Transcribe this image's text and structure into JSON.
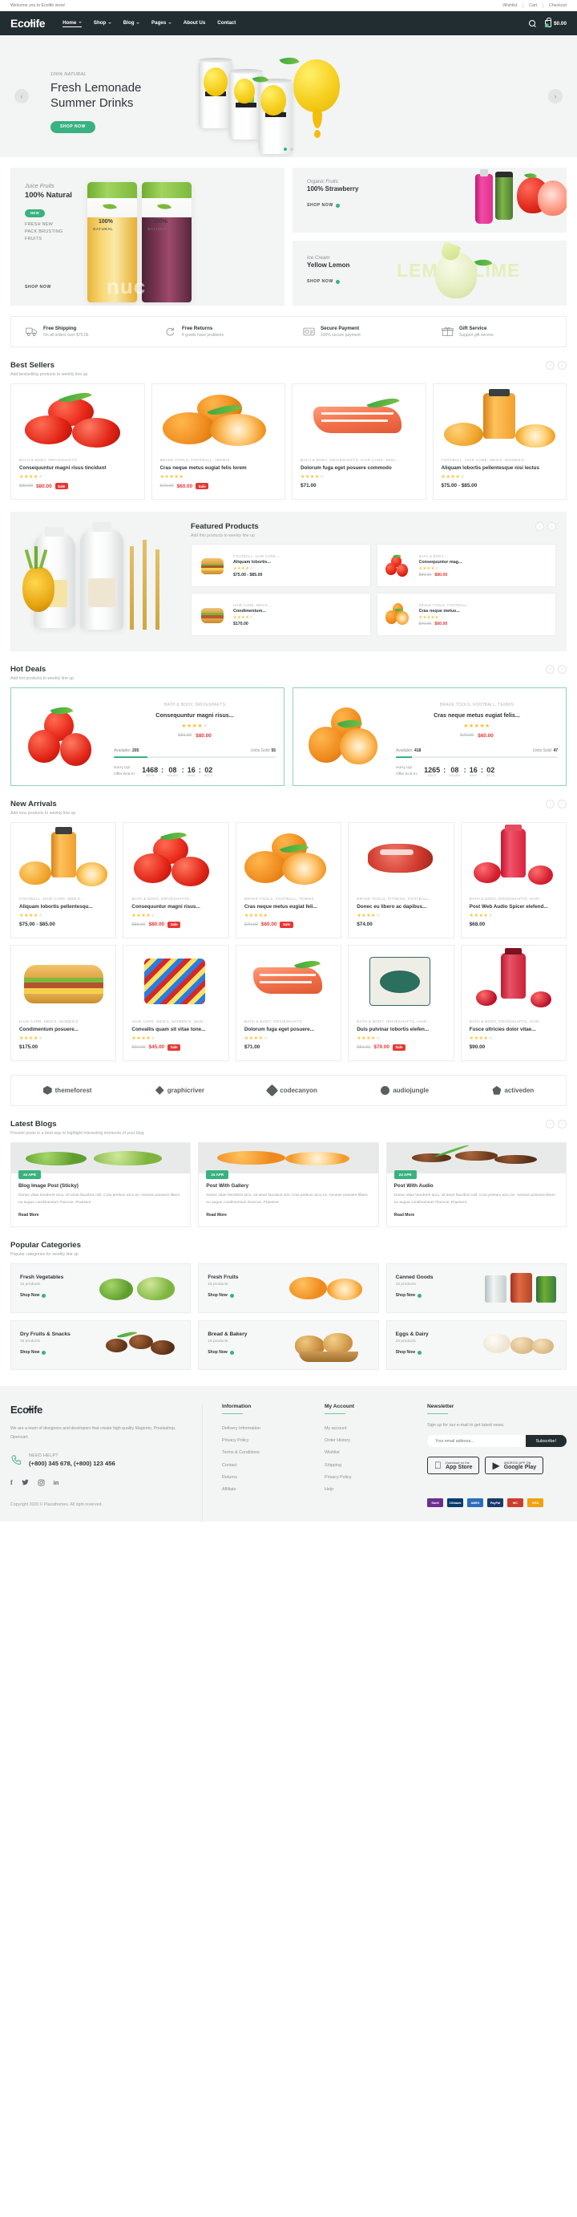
{
  "topbar": {
    "welcome": "Welcome you to Ecolife store!",
    "links": [
      "Wishlist",
      "Cart",
      "Checkout"
    ]
  },
  "header": {
    "logo": "Ecolife",
    "nav": [
      {
        "label": "Home",
        "caret": true,
        "active": true
      },
      {
        "label": "Shop",
        "caret": true,
        "active": false
      },
      {
        "label": "Blog",
        "caret": true,
        "active": false
      },
      {
        "label": "Pages",
        "caret": true,
        "active": false
      },
      {
        "label": "About Us",
        "caret": false,
        "active": false
      },
      {
        "label": "Contact",
        "caret": false,
        "active": false
      }
    ],
    "search_icon": "search-icon",
    "cart_icon": "cart-icon",
    "cart_count": "0",
    "cart_total": "$0.00"
  },
  "hero": {
    "eyebrow": "100% NATURAL",
    "title_line1": "Fresh Lemonade",
    "title_line2": "Summer Drinks",
    "cta": "SHOP NOW",
    "prev": "‹",
    "next": "›",
    "dots": 2,
    "active_dot": 0
  },
  "promos": {
    "large": {
      "eyebrow": "Juice Fruits",
      "title": "100% Natural",
      "badge": "NEW",
      "sub_line1": "FRESH NEW",
      "sub_line2": "PACK BRUSTING",
      "sub_line3": "FRUITS",
      "cta": "SHOP NOW",
      "label_a": "100%",
      "label_b": "NATURAL",
      "word": "nuc"
    },
    "small1": {
      "eyebrow": "Organic Fruits",
      "title": "100% Strawberry",
      "cta": "SHOP NOW"
    },
    "small2": {
      "eyebrow": "Ice Cream",
      "title": "Yellow Lemon",
      "cta": "SHOP NOW",
      "bigword": "LEMON LIME"
    }
  },
  "services": [
    {
      "icon": "truck-icon",
      "title": "Free Shipping",
      "sub": "On all orders over $75.00"
    },
    {
      "icon": "returns-icon",
      "title": "Free Returns",
      "sub": "If goods have problems"
    },
    {
      "icon": "secure-payment-icon",
      "title": "Secure Payment",
      "sub": "100% secure payment"
    },
    {
      "icon": "gift-icon",
      "title": "Gift Service",
      "sub": "Support gift service"
    }
  ],
  "best_sellers": {
    "title": "Best Sellers",
    "sub": "Add bestselling products to weekly line up",
    "products": [
      {
        "img": "tomatoes",
        "cat": "BATH & BODY, DRIVESHAFTS",
        "name": "Consequuntur magni risus tincidunt",
        "stars": 4,
        "old": "$89.00",
        "new": "$80.00",
        "sale": "Sale"
      },
      {
        "img": "oranges",
        "cat": "BRAKE TOOLS, FOOTBALL, TENNIS",
        "name": "Cras neque metus eugiat felis lorem",
        "stars": 5,
        "old": "$70.00",
        "new": "$60.00",
        "sale": "Sale"
      },
      {
        "img": "salmon",
        "cat": "BATH & BODY, DRIVESHAFTS, HAIR CARE, SKIN...",
        "name": "Dolorum fuga eget posuere commodo",
        "stars": 4,
        "reg": "$71.00"
      },
      {
        "img": "juice",
        "cat": "FOOTBALL, HAIR CARE, MEN'S, WOMEN'S",
        "name": "Aliquam lobortis pellentesque nisi lectus",
        "stars": 4,
        "reg": "$75.00 - $85.00"
      }
    ]
  },
  "featured": {
    "title": "Featured Products",
    "sub": "Add this products to weekly line up",
    "products": [
      {
        "img": "burger",
        "cat": "FOOTBALL, HAIR CARE,...",
        "name": "Aliquam lobortis...",
        "stars": 4,
        "reg": "$75.00 - $85.00"
      },
      {
        "img": "tomatoes",
        "cat": "BATH & BODY,...",
        "name": "Consequuntur mag...",
        "stars": 4,
        "old": "$89.00",
        "new": "$80.00"
      },
      {
        "img": "sandwich",
        "cat": "HAIR CARE, MEN'S,...",
        "name": "Condimentum...",
        "stars": 4,
        "reg": "$170.00"
      },
      {
        "img": "oranges",
        "cat": "BRAKE TOOLS, FOOTBALL...",
        "name": "Cras neque metus...",
        "stars": 5,
        "old": "$70.00",
        "new": "$60.00"
      }
    ]
  },
  "hot_deals": {
    "title": "Hot Deals",
    "sub": "Add hot products to weekly line up",
    "deals": [
      {
        "img": "tomatoes",
        "cat": "BATH & BODY, DRIVESHAFTS",
        "name": "Consequuntur magni risus...",
        "stars": 4,
        "old": "$89.00",
        "new": "$80.00",
        "available_label": "Available:",
        "available": "205",
        "sold_label": "Units Sold:",
        "sold": "55",
        "progress": 21,
        "hurry_l1": "Hurry Up!",
        "hurry_l2": "Offer End In:",
        "days": "1468",
        "hours": "08",
        "mins": "16",
        "secs": "02",
        "cap_days": "DAYS",
        "cap_hours": "HOURS",
        "cap_mins": "MINS",
        "cap_secs": "SECS"
      },
      {
        "img": "oranges",
        "cat": "BRAKE TOOLS, FOOTBALL, TENNIS",
        "name": "Cras neque metus eugiat felis...",
        "stars": 5,
        "old": "$70.00",
        "new": "$60.00",
        "available_label": "Available:",
        "available": "418",
        "sold_label": "Units Sold:",
        "sold": "47",
        "progress": 10,
        "hurry_l1": "Hurry Up!",
        "hurry_l2": "Offer End In:",
        "days": "1265",
        "hours": "08",
        "mins": "16",
        "secs": "02",
        "cap_days": "DAYS",
        "cap_hours": "HOURS",
        "cap_mins": "MINS",
        "cap_secs": "SECS"
      }
    ]
  },
  "new_arrivals": {
    "title": "New Arrivals",
    "sub": "Add new products to weekly line up",
    "products": [
      {
        "img": "juice",
        "cat": "FOOTBALL, HAIR CARE, MEN'S...",
        "name": "Aliquam lobortis pellentesqu...",
        "stars": 4,
        "reg": "$75.00 - $85.00"
      },
      {
        "img": "tomatoes",
        "cat": "BATH & BODY, DRIVESHAFTS",
        "name": "Consequuntur magni risus...",
        "stars": 4,
        "old": "$89.00",
        "new": "$80.00",
        "sale": "Sale"
      },
      {
        "img": "oranges",
        "cat": "BRAKE TOOLS, FOOTBALL, TENNIS",
        "name": "Cras neque metus eugiat feli...",
        "stars": 5,
        "old": "$70.00",
        "new": "$60.00",
        "sale": "Sale"
      },
      {
        "img": "meat",
        "cat": "BRAKE TOOLS, FITNESS, FOOTBALL...",
        "name": "Donec eu libero ac dapibus...",
        "stars": 4,
        "reg": "$74.00"
      },
      {
        "img": "smoothie",
        "cat": "BATH & BODY, DRIVESHAFTS, HAIR...",
        "name": "Post Web Audio Spicer elefend...",
        "stars": 4,
        "reg": "$68.00"
      },
      {
        "img": "burger",
        "cat": "HAIR CARE, MEN'S, WOMEN'S",
        "name": "Condimentum posuere...",
        "stars": 4,
        "reg": "$175.00"
      },
      {
        "img": "candy",
        "cat": "HAIR CARE, MEN'S, WOMEN'S, SKIN...",
        "name": "Convallis quam sit vitae tone...",
        "stars": 4,
        "old": "$60.00",
        "new": "$45.00",
        "sale": "Sale"
      },
      {
        "img": "salmon",
        "cat": "BATH & BODY, DRIVESHAFTS",
        "name": "Dolorum fuga eget posuere...",
        "stars": 4,
        "reg": "$71.00"
      },
      {
        "img": "tea",
        "cat": "BATH & BODY, DRIVESHAFTS, HAIR...",
        "name": "Duis pulvinar lobortis elefen...",
        "stars": 4,
        "old": "$82.00",
        "new": "$79.00",
        "sale": "Sale"
      },
      {
        "img": "cranberry",
        "cat": "BATH & BODY, DRIVESHAFTS, HAIR...",
        "name": "Fusce ultricies dolor vitae...",
        "stars": 4,
        "reg": "$90.00"
      }
    ]
  },
  "brands": [
    {
      "label": "themeforest",
      "icon": "hexagon-icon"
    },
    {
      "label": "graphicriver",
      "icon": "diamond-icon"
    },
    {
      "label": "codecanyon",
      "icon": "square-icon"
    },
    {
      "label": "audiojungle",
      "icon": "circle-icon"
    },
    {
      "label": "activeden",
      "icon": "pentagon-icon"
    }
  ],
  "blogs": {
    "title": "Latest Blogs",
    "sub": "Present posts in a best way to highlight interesting moments of your blog",
    "items": [
      {
        "date": "24 APR",
        "title": "Blog Image Post (Sticky)",
        "excerpt": "Donec vitae hendrerit arcu, sit amet faucibus nisl. Cras pretium arcu ex. Aenean posuere libero eu augue condimentum rhoncus. Praesent",
        "more": "Read More"
      },
      {
        "date": "24 APR",
        "title": "Post With Gallery",
        "excerpt": "Donec vitae hendrerit arcu, sit amet faucibus nisl. Cras pretium arcu ex. Aenean posuere libero eu augue condimentum rhoncus. Praesent",
        "more": "Read More"
      },
      {
        "date": "24 APR",
        "title": "Post With Audio",
        "excerpt": "Donec vitae hendrerit arcu, sit amet faucibus nisl. Cras pretium arcu ex. Aenean posuere libero eu augue condimentum rhoncus. Praesent",
        "more": "Read More"
      }
    ]
  },
  "categories": {
    "title": "Popular Categories",
    "sub": "Popular categories for weekly line up",
    "items": [
      {
        "name": "Fresh Vegetables",
        "count": "15 products",
        "cta": "Shop Now"
      },
      {
        "name": "Fresh Fruits",
        "count": "15 products",
        "cta": "Shop Now"
      },
      {
        "name": "Canned Goods",
        "count": "15 products",
        "cta": "Shop Now"
      },
      {
        "name": "Dry Fruits & Snacks",
        "count": "15 products",
        "cta": "Shop Now"
      },
      {
        "name": "Bread & Bakery",
        "count": "15 products",
        "cta": "Shop Now"
      },
      {
        "name": "Eggs & Dairy",
        "count": "15 products",
        "cta": "Shop Now"
      }
    ]
  },
  "footer": {
    "logo": "Ecolife",
    "desc": "We are a team of designers and developers that create high quality Magento, Prestashop, Opencart.",
    "help_label": "NEED HELP?",
    "help_number": "(+800) 345 678, (+800) 123 456",
    "socials": [
      "f",
      "ᵛ",
      "□",
      "in"
    ],
    "copyright": "Copyright 2020 © Plazathemes. All right reserved.",
    "information": {
      "heading": "Information",
      "links": [
        "Delivery Information",
        "Privacy Policy",
        "Terms & Conditions",
        "Contact",
        "Returns",
        "Affiliate"
      ]
    },
    "my_account": {
      "heading": "My Account",
      "links": [
        "My account",
        "Order History",
        "Wishlist",
        "Shipping",
        "Privacy Policy",
        "Help"
      ]
    },
    "newsletter": {
      "heading": "Newsletter",
      "text": "Sign up for our e-mail to get latest news.",
      "placeholder": "Your email address...",
      "button": "Subscribe!",
      "appstore_small": "Download on the",
      "appstore_big": "App Store",
      "play_small": "ANDROID APP ON",
      "play_big": "Google Play"
    },
    "payments": [
      "Skrill",
      "Citibank",
      "AMEX",
      "PayPal",
      "MC",
      "VISA"
    ]
  },
  "colors": {
    "accent": "#38b280",
    "dark": "#222d32",
    "sale_red": "#e53935",
    "star": "#fbc02d"
  }
}
